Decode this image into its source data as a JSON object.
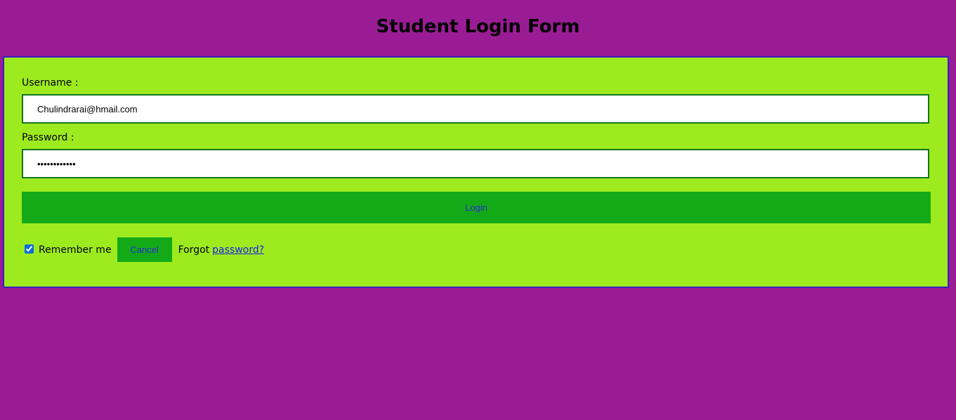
{
  "page": {
    "title": "Student Login Form"
  },
  "form": {
    "username_label": "Username :",
    "username_value": "Chulindrarai@hmail.com",
    "password_label": "Password :",
    "password_value": "••••••••••••",
    "login_label": "Login",
    "remember_label": "Remember me",
    "remember_checked": true,
    "cancel_label": "Cancel",
    "forgot_text": "Forgot",
    "forgot_link": "password?"
  },
  "colors": {
    "page_background": "#9a1c94",
    "form_background": "#9deb1f",
    "form_border": "#3a1fc0",
    "button_background": "#14aa17",
    "button_text": "#2b2bd0",
    "input_border": "#12751a",
    "link": "#1a1aee"
  }
}
